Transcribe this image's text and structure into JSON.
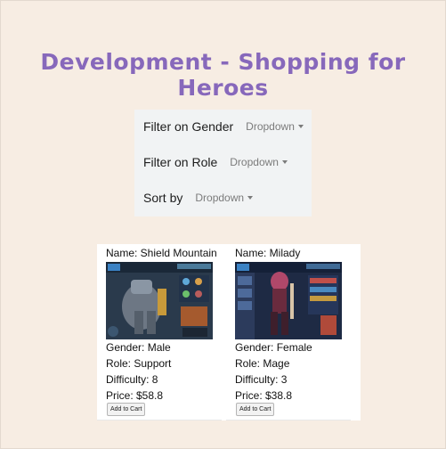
{
  "page": {
    "title": "Development - Shopping for Heroes"
  },
  "filters": [
    {
      "label": "Filter on Gender",
      "dropdown": "Dropdown"
    },
    {
      "label": "Filter on Role",
      "dropdown": "Dropdown"
    },
    {
      "label": "Sort by",
      "dropdown": "Dropdown"
    }
  ],
  "heroes": [
    {
      "name": "Name: Shield Mountain",
      "gender": "Gender: Male",
      "role": "Role: Support",
      "difficulty": "Difficulty: 8",
      "price": "Price: $58.8",
      "button": "Add to Cart"
    },
    {
      "name": "Name: Milady",
      "gender": "Gender: Female",
      "role": "Role: Mage",
      "difficulty": "Difficulty: 3",
      "price": "Price: $38.8",
      "button": "Add to Cart"
    }
  ],
  "colors": {
    "background": "#f7ede3",
    "title": "#8768bb",
    "filter_panel": "#f1f3f4"
  }
}
